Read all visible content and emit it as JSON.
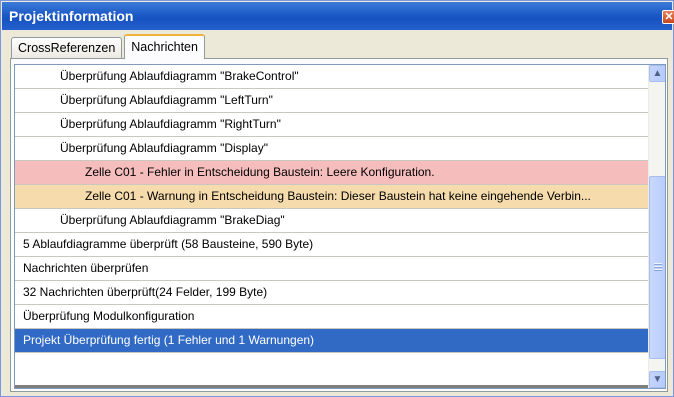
{
  "window": {
    "title": "Projektinformation",
    "close_glyph": "✕"
  },
  "tabs": [
    {
      "label": "CrossReferenzen",
      "active": false
    },
    {
      "label": "Nachrichten",
      "active": true
    }
  ],
  "messages": [
    {
      "text": "Überprüfung Ablaufdiagramm \"BrakeControl\"",
      "level": 1,
      "type": "info"
    },
    {
      "text": "Überprüfung Ablaufdiagramm \"LeftTurn\"",
      "level": 1,
      "type": "info"
    },
    {
      "text": "Überprüfung Ablaufdiagramm \"RightTurn\"",
      "level": 1,
      "type": "info"
    },
    {
      "text": "Überprüfung Ablaufdiagramm \"Display\"",
      "level": 1,
      "type": "info"
    },
    {
      "text": "Zelle C01 - Fehler in Entscheidung Baustein: Leere Konfiguration.",
      "level": 2,
      "type": "error"
    },
    {
      "text": "Zelle C01 - Warnung in Entscheidung Baustein: Dieser Baustein hat keine eingehende Verbin...",
      "level": 2,
      "type": "warning"
    },
    {
      "text": "Überprüfung Ablaufdiagramm \"BrakeDiag\"",
      "level": 1,
      "type": "info"
    },
    {
      "text": "5 Ablaufdiagramme überprüft (58 Bausteine, 590 Byte)",
      "level": 0,
      "type": "info"
    },
    {
      "text": "Nachrichten überprüfen",
      "level": 0,
      "type": "info"
    },
    {
      "text": "32 Nachrichten überprüft(24 Felder, 199 Byte)",
      "level": 0,
      "type": "info"
    },
    {
      "text": "Überprüfung Modulkonfiguration",
      "level": 0,
      "type": "info"
    },
    {
      "text": "Projekt Überprüfung fertig (1 Fehler und 1 Warnungen)",
      "level": 0,
      "type": "selected"
    }
  ],
  "scrollbar": {
    "up_icon": "chevron-up-icon",
    "down_icon": "chevron-down-icon"
  },
  "colors": {
    "titlebar": "#1c5ac8",
    "error_row": "#f6bdbd",
    "warning_row": "#f6dcac",
    "selected_row": "#316ac5"
  }
}
